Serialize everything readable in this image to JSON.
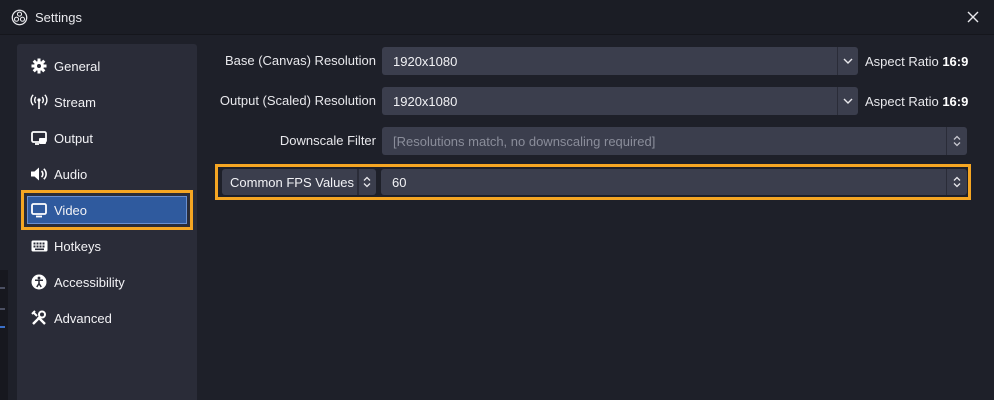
{
  "window": {
    "title": "Settings",
    "logo_icon": "obs-logo-icon",
    "close_icon": "close-icon"
  },
  "sidebar": {
    "items": [
      {
        "label": "General",
        "icon": "gear-icon"
      },
      {
        "label": "Stream",
        "icon": "broadcast-icon"
      },
      {
        "label": "Output",
        "icon": "output-icon"
      },
      {
        "label": "Audio",
        "icon": "speaker-icon"
      },
      {
        "label": "Video",
        "icon": "monitor-icon",
        "selected": true
      },
      {
        "label": "Hotkeys",
        "icon": "keyboard-icon"
      },
      {
        "label": "Accessibility",
        "icon": "accessibility-icon"
      },
      {
        "label": "Advanced",
        "icon": "tools-icon"
      }
    ]
  },
  "video": {
    "base_resolution": {
      "label": "Base (Canvas) Resolution",
      "value": "1920x1080",
      "aspect_prefix": "Aspect Ratio",
      "aspect_value": "16:9"
    },
    "output_resolution": {
      "label": "Output (Scaled) Resolution",
      "value": "1920x1080",
      "aspect_prefix": "Aspect Ratio",
      "aspect_value": "16:9"
    },
    "downscale_filter": {
      "label": "Downscale Filter",
      "value": "[Resolutions match, no downscaling required]"
    },
    "fps": {
      "type_label": "Common FPS Values",
      "value": "60"
    }
  },
  "colors": {
    "highlight": "#f5a623",
    "selected_bg": "#2f5a9e",
    "panel_bg": "#2a2c38",
    "window_bg": "#1e2029",
    "input_bg": "#3b3e4d"
  }
}
